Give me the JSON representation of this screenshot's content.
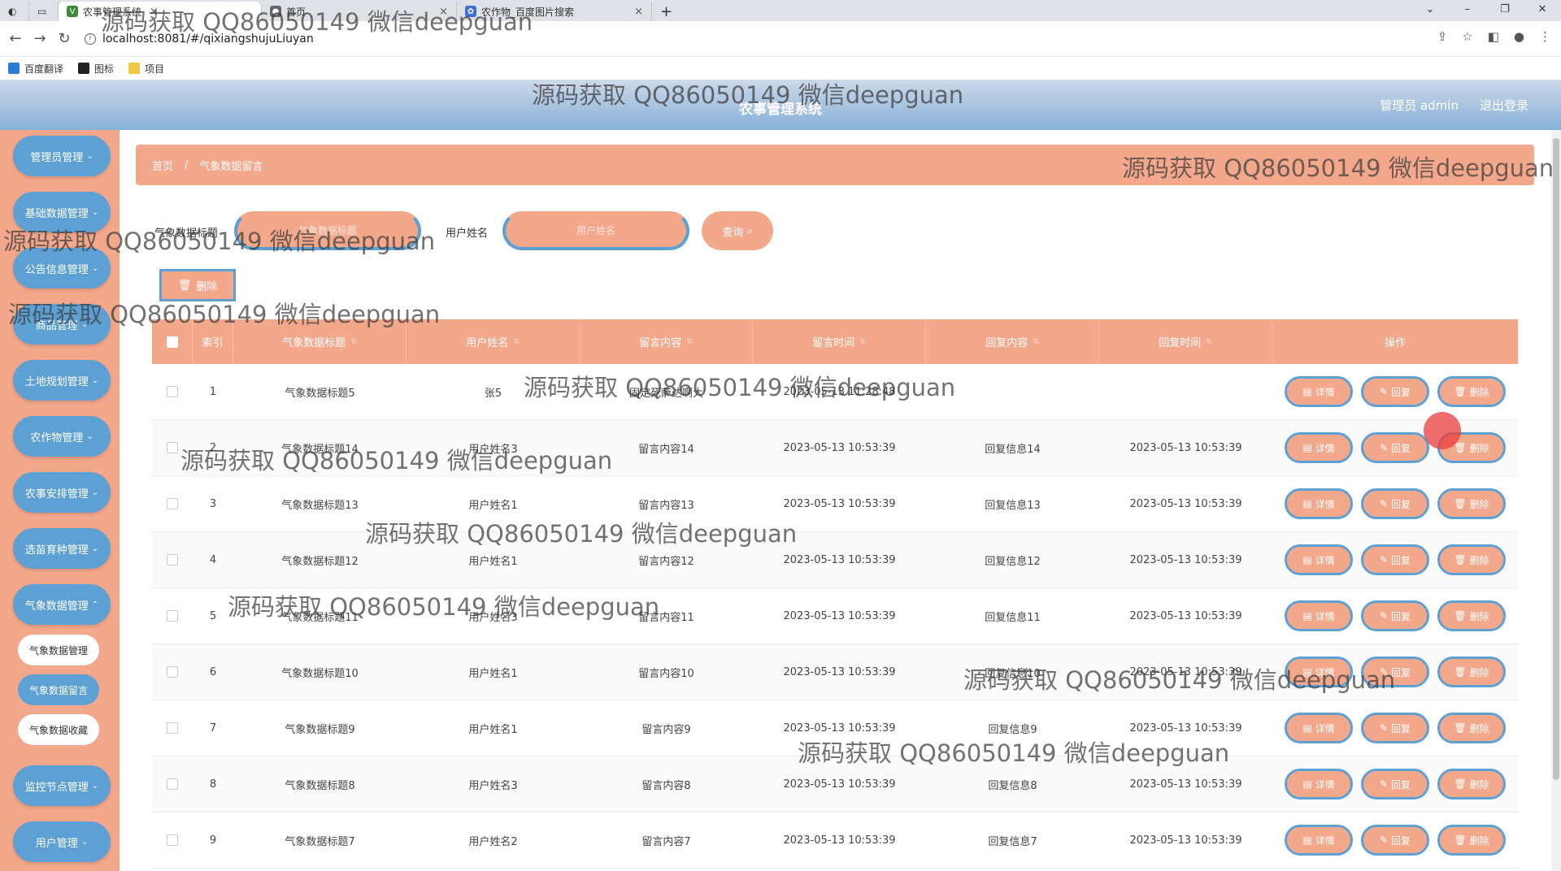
{
  "browser": {
    "tabs": [
      {
        "label": "农事管理系统",
        "active": true
      },
      {
        "label": "首页",
        "active": false
      },
      {
        "label": "农作物_百度图片搜索",
        "active": false
      }
    ],
    "new_tab": "+",
    "url": "localhost:8081/#/qixiangshujuLiuyan",
    "bookmarks": [
      "百度翻译",
      "图标",
      "项目"
    ]
  },
  "header": {
    "title": "农事管理系统",
    "user_label": "管理员 admin",
    "logout_label": "退出登录"
  },
  "sidebar": {
    "menus": [
      "管理员管理",
      "基础数据管理",
      "公告信息管理",
      "商品管理",
      "土地规划管理",
      "农作物管理",
      "农事安排管理",
      "选苗育种管理",
      "气象数据管理",
      "监控节点管理",
      "用户管理"
    ],
    "submenus": [
      "气象数据管理",
      "气象数据留言",
      "气象数据收藏"
    ]
  },
  "breadcrumb": {
    "home": "首页",
    "current": "气象数据留言"
  },
  "search": {
    "title_label": "气象数据标题",
    "title_placeholder": "气象数据标题",
    "user_label": "用户姓名",
    "user_placeholder": "用户姓名",
    "query_label": "查询",
    "delete_label": "删除"
  },
  "table": {
    "headers": [
      "索引",
      "气象数据标题",
      "用户姓名",
      "留言内容",
      "留言时间",
      "回复内容",
      "回复时间",
      "操作"
    ],
    "rows": [
      [
        "1",
        "气象数据标题5",
        "张5",
        "固定死萨达啊大",
        "2023-05-13 11:28:48",
        "",
        ""
      ],
      [
        "2",
        "气象数据标题14",
        "用户姓名3",
        "留言内容14",
        "2023-05-13 10:53:39",
        "回复信息14",
        "2023-05-13 10:53:39"
      ],
      [
        "3",
        "气象数据标题13",
        "用户姓名1",
        "留言内容13",
        "2023-05-13 10:53:39",
        "回复信息13",
        "2023-05-13 10:53:39"
      ],
      [
        "4",
        "气象数据标题12",
        "用户姓名1",
        "留言内容12",
        "2023-05-13 10:53:39",
        "回复信息12",
        "2023-05-13 10:53:39"
      ],
      [
        "5",
        "气象数据标题11",
        "用户姓名3",
        "留言内容11",
        "2023-05-13 10:53:39",
        "回复信息11",
        "2023-05-13 10:53:39"
      ],
      [
        "6",
        "气象数据标题10",
        "用户姓名1",
        "留言内容10",
        "2023-05-13 10:53:39",
        "回复信息10",
        "2023-05-13 10:53:39"
      ],
      [
        "7",
        "气象数据标题9",
        "用户姓名1",
        "留言内容9",
        "2023-05-13 10:53:39",
        "回复信息9",
        "2023-05-13 10:53:39"
      ],
      [
        "8",
        "气象数据标题8",
        "用户姓名3",
        "留言内容8",
        "2023-05-13 10:53:39",
        "回复信息8",
        "2023-05-13 10:53:39"
      ],
      [
        "9",
        "气象数据标题7",
        "用户姓名2",
        "留言内容7",
        "2023-05-13 10:53:39",
        "回复信息7",
        "2023-05-13 10:53:39"
      ]
    ],
    "actions": {
      "detail": "详情",
      "reply": "回复",
      "delete": "删除"
    }
  },
  "watermark": "源码获取 QQ86050149 微信deepguan",
  "colors": {
    "primary_salmon": "#f4a88b",
    "accent_blue": "#5da0d4",
    "header_gradient_top": "#cdd9ea"
  }
}
